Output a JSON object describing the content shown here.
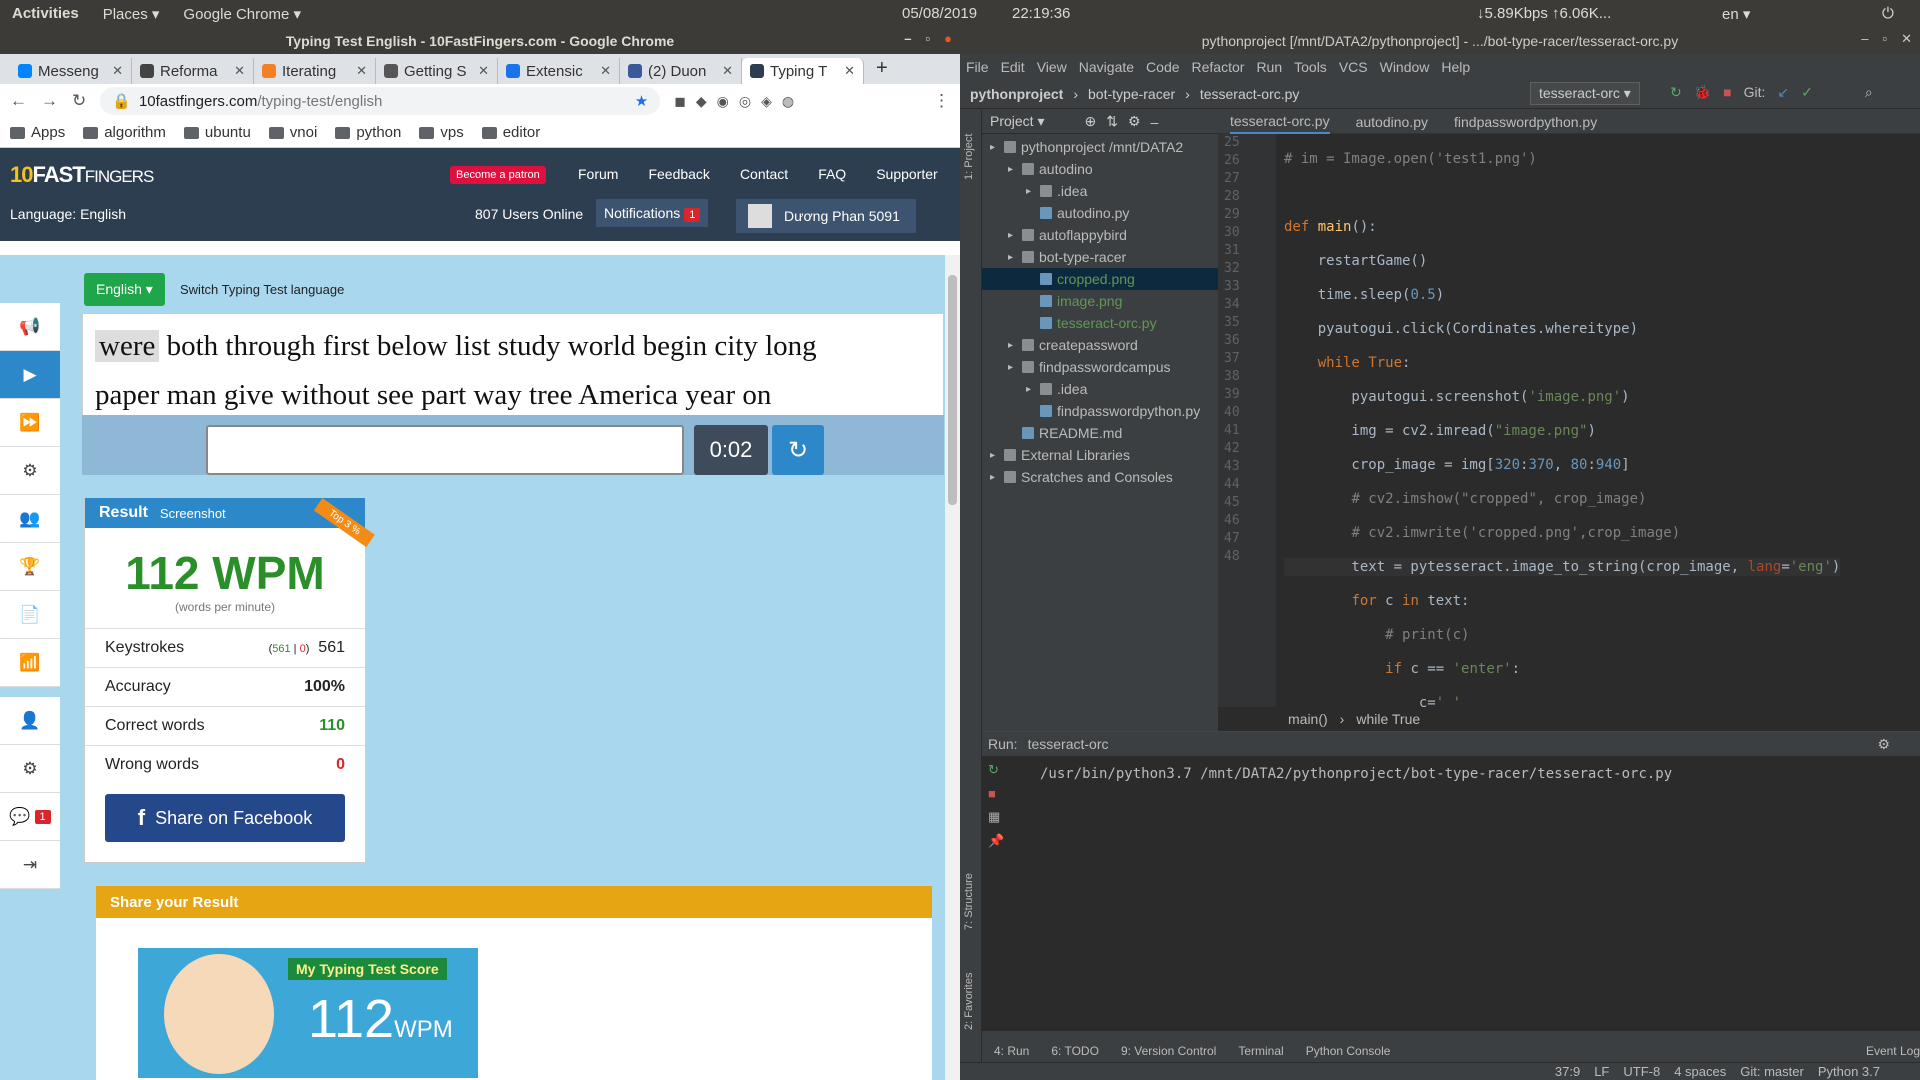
{
  "topbar": {
    "activities": "Activities",
    "places": "Places ▾",
    "app": "Google Chrome ▾",
    "date": "05/08/2019",
    "time": "22:19:36",
    "net": "↓5.89Kbps ↑6.06K...",
    "lang": "en ▾"
  },
  "chrome": {
    "title": "Typing Test English - 10FastFingers.com - Google Chrome",
    "tabs": [
      {
        "label": "Messeng",
        "color": "#0084ff"
      },
      {
        "label": "Reforma",
        "color": "#444"
      },
      {
        "label": "Iterating",
        "color": "#f48024"
      },
      {
        "label": "Getting S",
        "color": "#555"
      },
      {
        "label": "Extensic",
        "color": "#1a73e8"
      },
      {
        "label": "(2) Duon",
        "color": "#3b5998"
      },
      {
        "label": "Typing T",
        "color": "#2c3e50"
      }
    ],
    "url_host": "10fastfingers.com",
    "url_path": "/typing-test/english",
    "bookmarks": [
      "Apps",
      "algorithm",
      "ubuntu",
      "vnoi",
      "python",
      "vps",
      "editor"
    ]
  },
  "site": {
    "logo_a": "10",
    "logo_b": "FAST",
    "logo_c": "FINGERS",
    "patron": "Become a patron",
    "nav": [
      "Forum",
      "Feedback",
      "Contact",
      "FAQ",
      "Supporter"
    ],
    "language": "Language: English",
    "users_online": "807 Users Online",
    "notifications": "Notifications",
    "notif_count": "1",
    "username": "Dương Phan 5091",
    "english_btn": "English ▾",
    "switch": "Switch Typing Test language",
    "first_word": "were",
    "words_line1": "both through first below list study world begin city long",
    "words_line2": "paper man give without see part way tree America year on",
    "timer": "0:02",
    "result": {
      "title": "Result",
      "tab": "Screenshot",
      "ribbon": "Top 3 %",
      "wpm": "112 WPM",
      "wpm_sub": "(words per minute)",
      "keystrokes_label": "Keystrokes",
      "keystrokes_good": "561",
      "keystrokes_bad": "0",
      "keystrokes": "561",
      "accuracy_label": "Accuracy",
      "accuracy": "100%",
      "correct_label": "Correct words",
      "correct": "110",
      "wrong_label": "Wrong words",
      "wrong": "0",
      "fb": "Share on Facebook"
    },
    "share_title": "Share your Result",
    "score_caption": "My Typing Test Score",
    "score_num": "112",
    "score_unit": "WPM",
    "side_badge": "1"
  },
  "ide": {
    "title": "pythonproject [/mnt/DATA2/pythonproject] - .../bot-type-racer/tesseract-orc.py",
    "menu": [
      "File",
      "Edit",
      "View",
      "Navigate",
      "Code",
      "Refactor",
      "Run",
      "Tools",
      "VCS",
      "Window",
      "Help"
    ],
    "crumbs": [
      "pythonproject",
      "bot-type-racer",
      "tesseract-orc.py"
    ],
    "runcfg": "tesseract-orc ▾",
    "git": "Git:",
    "project_label": "Project ▾",
    "tree": [
      {
        "t": "pythonproject  /mnt/DATA2",
        "d": 0,
        "k": "dir"
      },
      {
        "t": "autodino",
        "d": 1,
        "k": "dir"
      },
      {
        "t": ".idea",
        "d": 2,
        "k": "dir"
      },
      {
        "t": "autodino.py",
        "d": 2,
        "k": "file"
      },
      {
        "t": "autoflappybird",
        "d": 1,
        "k": "dir"
      },
      {
        "t": "bot-type-racer",
        "d": 1,
        "k": "dir"
      },
      {
        "t": "cropped.png",
        "d": 2,
        "k": "file"
      },
      {
        "t": "image.png",
        "d": 2,
        "k": "file"
      },
      {
        "t": "tesseract-orc.py",
        "d": 2,
        "k": "file"
      },
      {
        "t": "createpassword",
        "d": 1,
        "k": "dir"
      },
      {
        "t": "findpasswordcampus",
        "d": 1,
        "k": "dir"
      },
      {
        "t": ".idea",
        "d": 2,
        "k": "dir"
      },
      {
        "t": "findpasswordpython.py",
        "d": 2,
        "k": "file"
      },
      {
        "t": "README.md",
        "d": 1,
        "k": "file"
      },
      {
        "t": "External Libraries",
        "d": 0,
        "k": "dir"
      },
      {
        "t": "Scratches and Consoles",
        "d": 0,
        "k": "dir"
      }
    ],
    "edtabs": [
      "tesseract-orc.py",
      "autodino.py",
      "findpasswordpython.py"
    ],
    "lines": [
      "25",
      "26",
      "27",
      "28",
      "29",
      "30",
      "31",
      "32",
      "33",
      "34",
      "35",
      "36",
      "37",
      "38",
      "39",
      "40",
      "41",
      "42",
      "43",
      "44",
      "45",
      "46",
      "47",
      "48"
    ],
    "breadcrumb": [
      "main()",
      "while True"
    ],
    "run_label": "Run:",
    "run_tab": "tesseract-orc",
    "run_cmd": "/usr/bin/python3.7 /mnt/DATA2/pythonproject/bot-type-racer/tesseract-orc.py",
    "bottom": [
      "4: Run",
      "6: TODO",
      "9: Version Control",
      "Terminal",
      "Python Console",
      "Event Log"
    ],
    "side_labels": [
      "1: Project",
      "7: Structure",
      "2: Favorites"
    ],
    "status": [
      "37:9",
      "LF",
      "UTF-8",
      "4 spaces",
      "Git: master",
      "Python 3.7"
    ]
  },
  "colors": {
    "accent": "#2c88c9",
    "wpm": "#2a8f28",
    "wrong": "#d9262c"
  }
}
